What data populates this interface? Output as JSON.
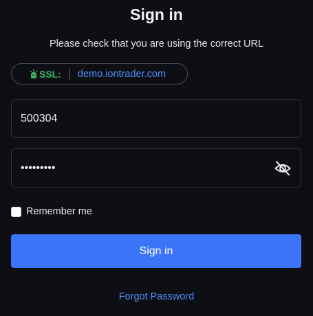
{
  "header": {
    "title": "Sign in",
    "subtitle": "Please check that you are using the correct URL"
  },
  "ssl": {
    "icon": "robot-lock-icon",
    "label": "SSL:",
    "url": "demo.iontrader.com",
    "label_color": "#3fb65f",
    "url_color": "#4f8cf7"
  },
  "form": {
    "login_value": "500304",
    "password_value": "123456789",
    "password_toggle_icon": "eye-off-icon",
    "remember_label": "Remember me",
    "remember_checked": false,
    "submit_label": "Sign in",
    "forgot_label": "Forgot Password"
  },
  "colors": {
    "background": "#0e0f14",
    "accent": "#3b74f6",
    "link": "#4f8cf7"
  }
}
